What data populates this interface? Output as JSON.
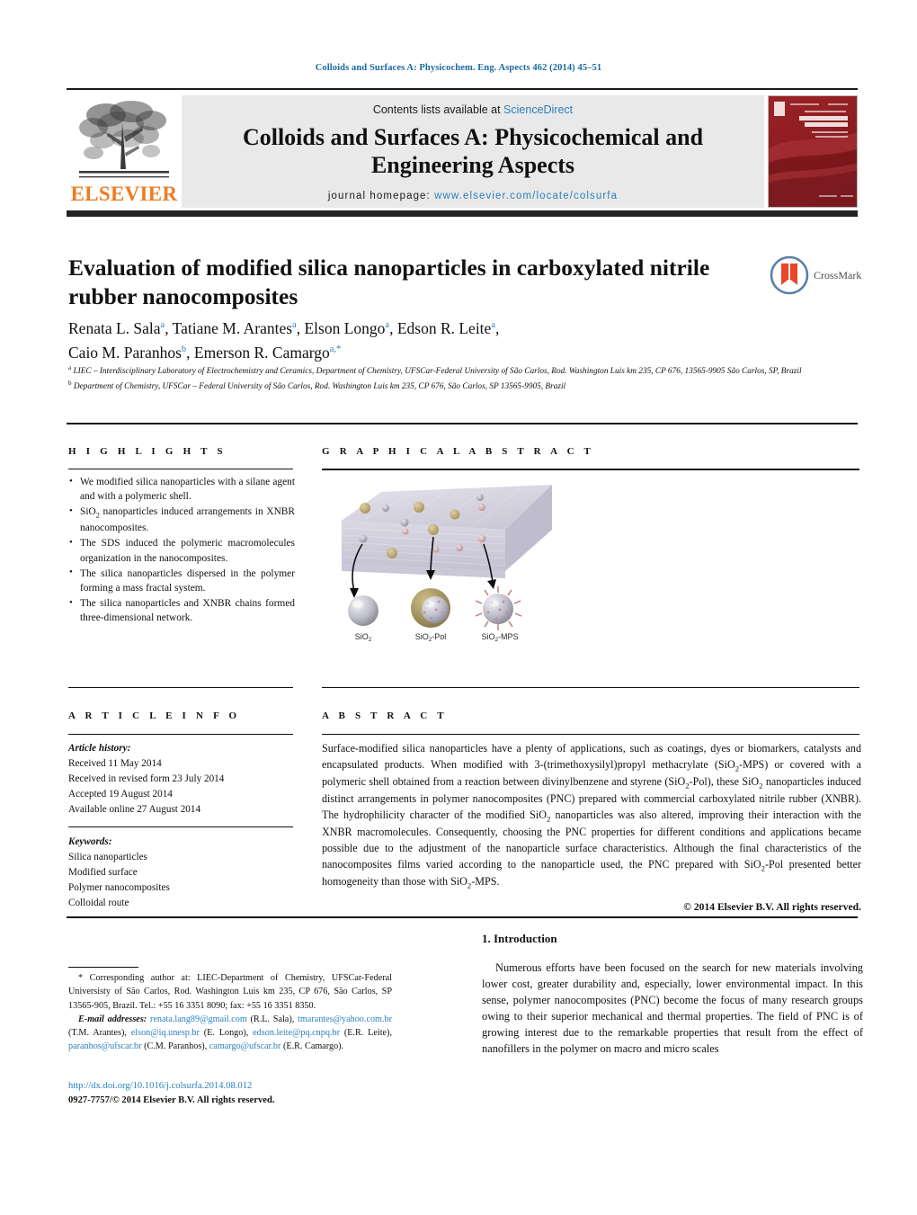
{
  "running_head": "Colloids and Surfaces A: Physicochem. Eng. Aspects 462 (2014) 45–51",
  "journal_header": {
    "contents_prefix": "Contents lists available at ",
    "sciencedirect": "ScienceDirect",
    "title": "Colloids and Surfaces A: Physicochemical and Engineering Aspects",
    "homepage_label": "journal homepage:",
    "homepage_url": "www.elsevier.com/locate/colsurfa",
    "publisher": "ELSEVIER",
    "cover_alt": "Colloids and Surfaces A journal cover"
  },
  "article": {
    "title": "Evaluation of modified silica nanoparticles in carboxylated nitrile rubber nanocomposites",
    "crossmark_label": "CrossMark",
    "authors_line1": "Renata L. Sala",
    "authors": [
      {
        "name": "Renata L. Sala",
        "sup": "a"
      },
      {
        "name": "Tatiane M. Arantes",
        "sup": "a"
      },
      {
        "name": "Elson Longo",
        "sup": "a"
      },
      {
        "name": "Edson R. Leite",
        "sup": "a"
      },
      {
        "name": "Caio M. Paranhos",
        "sup": "b"
      },
      {
        "name": "Emerson R. Camargo",
        "sup": "a,*"
      }
    ],
    "affiliations": [
      {
        "mark": "a",
        "text": "LIEC – Interdisciplinary Laboratory of Electrochemistry and Ceramics, Department of Chemistry, UFSCar-Federal University of São Carlos, Rod. Washington Luis km 235, CP 676, 13565-9905 São Carlos, SP, Brazil"
      },
      {
        "mark": "b",
        "text": "Department of Chemistry, UFSCar – Federal University of São Carlos, Rod. Washington Luis km 235, CP 676, São Carlos, SP 13565-9905, Brazil"
      }
    ]
  },
  "sections": {
    "highlights_head": "H I G H L I G H T S",
    "graphical_abstract_head": "G R A P H I C A L   A B S T R A C T",
    "article_info_head": "A R T I C L E   I N F O",
    "abstract_head": "A B S T R A C T"
  },
  "highlights": [
    "We modified silica nanoparticles with a silane agent and with a polymeric shell.",
    "SiO2 nanoparticles induced arrangements in XNBR nanocomposites.",
    "The SDS induced the polymeric macromolecules organization in the nanocomposites.",
    "The silica nanoparticles dispersed in the polymer forming a mass fractal system.",
    "The silica nanoparticles and XNBR chains formed three-dimensional network."
  ],
  "graphical_abstract": {
    "labels": [
      "SiO2",
      "SiO2-Pol",
      "SiO2-MPS"
    ],
    "matrix_color": "#d4d2de",
    "particle_gold": "#b8a46a",
    "particle_grey": "#aaa9b6",
    "particle_pink": "#c7a7a7"
  },
  "article_info": {
    "history_label": "Article history:",
    "history": [
      "Received 11 May 2014",
      "Received in revised form 23 July 2014",
      "Accepted 19 August 2014",
      "Available online 27 August 2014"
    ],
    "keywords_label": "Keywords:",
    "keywords": [
      "Silica nanoparticles",
      "Modified surface",
      "Polymer nanocomposites",
      "Colloidal route"
    ]
  },
  "abstract": {
    "text": "Surface-modified silica nanoparticles have a plenty of applications, such as coatings, dyes or biomarkers, catalysts and encapsulated products. When modified with 3-(trimethoxysilyl)propyl methacrylate (SiO2-MPS) or covered with a polymeric shell obtained from a reaction between divinylbenzene and styrene (SiO2-Pol), these SiO2 nanoparticles induced distinct arrangements in polymer nanocomposites (PNC) prepared with commercial carboxylated nitrile rubber (XNBR). The hydrophilicity character of the modified SiO2 nanoparticles was also altered, improving their interaction with the XNBR macromolecules. Consequently, choosing the PNC properties for different conditions and applications became possible due to the adjustment of the nanoparticle surface characteristics. Although the final characteristics of the nanocomposites films varied according to the nanoparticle used, the PNC prepared with SiO2-Pol presented better homogeneity than those with SiO2-MPS.",
    "copyright": "© 2014 Elsevier B.V. All rights reserved."
  },
  "footnote": {
    "corresponding": "* Corresponding author at: LIEC-Department of Chemistry, UFSCar-Federal Universisty of São Carlos, Rod. Washington Luis km 235, CP 676, São Carlos, SP 13565-905, Brazil. Tel.: +55 16 3351 8090; fax: +55 16 3351 8350.",
    "email_label": "E-mail addresses:",
    "emails": [
      {
        "address": "renata.lang89@gmail.com",
        "owner": "(R.L. Sala)"
      },
      {
        "address": "tmarantes@yahoo.com.br",
        "owner": "(T.M. Arantes)"
      },
      {
        "address": "elson@iq.unesp.br",
        "owner": "(E. Longo)"
      },
      {
        "address": "edson.leite@pq.cnpq.br",
        "owner": "(E.R. Leite)"
      },
      {
        "address": "paranhos@ufscar.br",
        "owner": "(C.M. Paranhos)"
      },
      {
        "address": "camargo@ufscar.br",
        "owner": "(E.R. Camargo)"
      }
    ]
  },
  "doi_block": {
    "doi_url": "http://dx.doi.org/10.1016/j.colsurfa.2014.08.012",
    "issn_copyright": "0927-7757/© 2014 Elsevier B.V. All rights reserved."
  },
  "introduction": {
    "heading": "1. Introduction",
    "paragraph": "Numerous efforts have been focused on the search for new materials involving lower cost, greater durability and, especially, lower environmental impact. In this sense, polymer nanocomposites (PNC) become the focus of many research groups owing to their superior mechanical and thermal properties. The field of PNC is of growing interest due to the remarkable properties that result from the effect of nanofillers in the polymer on macro and micro scales"
  },
  "colors": {
    "link_blue": "#2b7fbd",
    "elsevier_orange": "#ef7c22",
    "cover_red": "#8f1d21",
    "black_bar": "#232323"
  }
}
